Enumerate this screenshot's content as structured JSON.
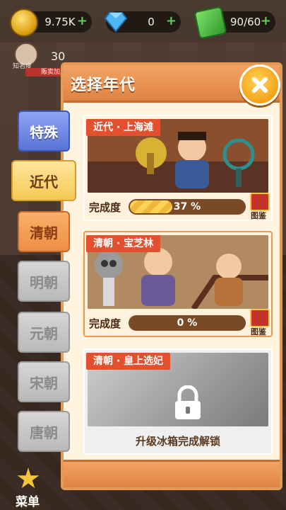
{
  "resources": {
    "coins": "9.75K",
    "gems": "0",
    "energy": "90/60",
    "plus": "+"
  },
  "hud": {
    "reputation_label": "知名度",
    "reputation_value": "30",
    "badge_text": "贩卖加成"
  },
  "panel": {
    "title": "选择年代"
  },
  "tabs": [
    {
      "label": "特殊",
      "state": "blue"
    },
    {
      "label": "近代",
      "state": "active"
    },
    {
      "label": "清朝",
      "state": "orange"
    },
    {
      "label": "明朝",
      "state": "locked"
    },
    {
      "label": "元朝",
      "state": "locked"
    },
    {
      "label": "宋朝",
      "state": "locked"
    },
    {
      "label": "唐朝",
      "state": "locked"
    }
  ],
  "cards": [
    {
      "tag": "近代 · 上海滩",
      "progress_label": "完成度",
      "progress_text": "37 %",
      "progress": 0.37,
      "book_label": "图鉴"
    },
    {
      "tag": "清朝 · 宝芝林",
      "progress_label": "完成度",
      "progress_text": "0 %",
      "progress": 0,
      "book_label": "图鉴"
    },
    {
      "tag": "清朝 · 皇上选妃",
      "locked_text": "升级冰箱完成解锁"
    }
  ],
  "menu": {
    "label": "菜单"
  },
  "colors": {
    "accent": "#e29a55",
    "tag_red": "#e2502f",
    "active_tab": "#f5c955",
    "special_tab": "#5a73d6"
  }
}
